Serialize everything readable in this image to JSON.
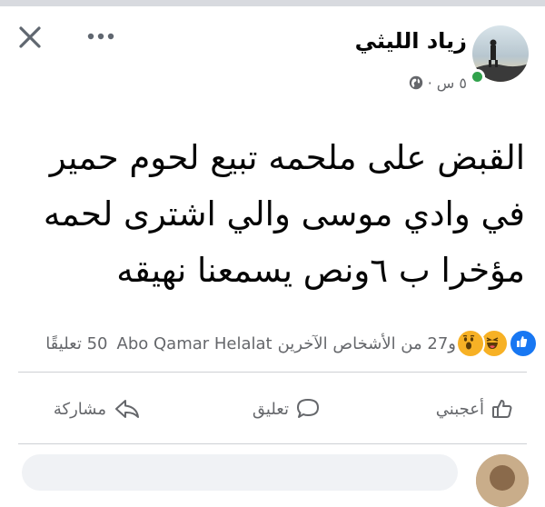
{
  "post": {
    "author": "زياد الليثي",
    "time": "٥ س",
    "separator": "·",
    "text": "القبض على ملحمه تبيع لحوم حمير في وادي موسى والي اشترى لحمه مؤخرا ب ٦ونص يسمعنا نهيقه"
  },
  "reactions": {
    "count": "27",
    "summary_prefix": "و",
    "summary_rest": "من الأشخاص الآخرين",
    "reactor_name": "Abo Qamar Helalat",
    "comments_count": "50",
    "comments_label": "تعليقًا",
    "icons": [
      "like-icon",
      "haha-icon",
      "wow-icon"
    ]
  },
  "actions": {
    "like": "أعجبني",
    "comment": "تعليق",
    "share": "مشاركة"
  },
  "colors": {
    "like_blue": "#1877f2",
    "online_green": "#31a24c",
    "secondary_text": "#65676b"
  }
}
